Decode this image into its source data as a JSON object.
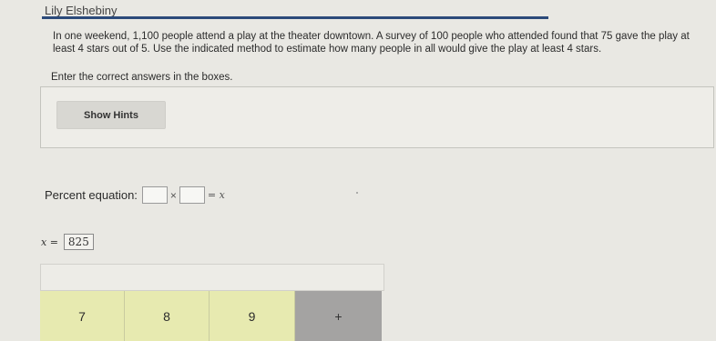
{
  "header": {
    "user_name": "Lily Elshebiny"
  },
  "question": {
    "text": "In one weekend, 1,100 people attend a play at the theater downtown. A survey of 100 people who attended found that 75 gave the play at least 4 stars out of 5. Use the indicated method to estimate how many people in all would give the play at least 4 stars.",
    "instruction": "Enter the correct answers in the boxes."
  },
  "hints": {
    "button_label": "Show Hints"
  },
  "percent_equation": {
    "label": "Percent equation:",
    "times_symbol": "×",
    "rhs": "= x",
    "box1_value": "",
    "box2_value": ""
  },
  "answer": {
    "variable": "x =",
    "value": "825"
  },
  "keypad": {
    "keys": [
      "7",
      "8",
      "9",
      "+"
    ]
  },
  "colors": {
    "accent_rule": "#2c4a7a",
    "key_bg": "#e7eab0",
    "key_active": "#a4a3a2"
  }
}
